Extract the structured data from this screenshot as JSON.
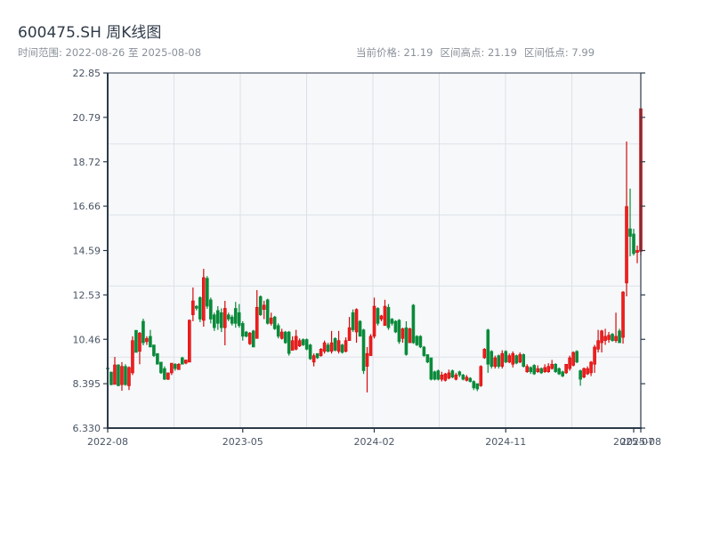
{
  "header": {
    "title": "600475.SH 周K线图",
    "range_label": "时间范围: 2022-08-26 至 2025-08-08",
    "current_price": "当前价格: 21.19",
    "range_high": "区间高点: 21.19",
    "range_low": "区间低点: 7.99"
  },
  "colors": {
    "up": "#d40a0a",
    "up_fill": "#f01e1e",
    "down": "#0a8a3a",
    "plot_bg": "#f6f8fa",
    "grid": "#dde1e8",
    "axis": "#2d3a4a"
  },
  "chart_data": {
    "type": "candlestick",
    "title": "600475.SH 周K线图",
    "ylim": [
      6.33,
      22.85
    ],
    "grid": true,
    "y_ticks": [
      "22.85",
      "20.79",
      "18.72",
      "16.66",
      "14.59",
      "12.53",
      "10.46",
      "8.395",
      "6.330"
    ],
    "x_ticks": [
      {
        "label": "2022-08",
        "index": 0
      },
      {
        "label": "2023-05",
        "index": 38
      },
      {
        "label": "2024-02",
        "index": 75
      },
      {
        "label": "2024-11",
        "index": 112
      },
      {
        "label": "2025-07",
        "index": 148
      },
      {
        "label": "2025-08",
        "index": 150
      }
    ],
    "fields": [
      "open",
      "close",
      "high",
      "low"
    ],
    "candles": [
      [
        9.12,
        9.08,
        9.15,
        9.05
      ],
      [
        8.94,
        8.35,
        8.94,
        8.32
      ],
      [
        8.36,
        9.27,
        9.64,
        8.36
      ],
      [
        9.27,
        8.3,
        9.3,
        8.28
      ],
      [
        8.35,
        9.2,
        9.4,
        8.07
      ],
      [
        9.2,
        8.35,
        9.3,
        8.3
      ],
      [
        8.3,
        9.15,
        9.2,
        8.1
      ],
      [
        8.9,
        10.4,
        10.6,
        8.8
      ],
      [
        10.88,
        9.85,
        10.88,
        9.85
      ],
      [
        9.9,
        10.75,
        10.8,
        9.3
      ],
      [
        11.3,
        10.3,
        11.42,
        10.18
      ],
      [
        10.35,
        10.5,
        10.6,
        10.2
      ],
      [
        10.6,
        10.1,
        10.9,
        10.1
      ],
      [
        10.2,
        9.7,
        10.2,
        9.64
      ],
      [
        9.8,
        9.3,
        9.8,
        9.3
      ],
      [
        9.4,
        8.9,
        9.4,
        8.85
      ],
      [
        9.1,
        8.6,
        9.2,
        8.57
      ],
      [
        8.6,
        8.9,
        8.9,
        8.57
      ],
      [
        8.9,
        9.35,
        9.35,
        8.8
      ],
      [
        9.3,
        9.1,
        9.35,
        9.0
      ],
      [
        9.05,
        9.3,
        9.35,
        9.05
      ],
      [
        9.6,
        9.3,
        9.65,
        9.3
      ],
      [
        9.35,
        9.5,
        9.5,
        9.3
      ],
      [
        9.4,
        11.35,
        11.38,
        9.4
      ],
      [
        11.6,
        12.25,
        12.87,
        11.3
      ],
      [
        12.0,
        11.9,
        12.05,
        11.8
      ],
      [
        12.4,
        11.4,
        12.46,
        11.26
      ],
      [
        11.34,
        13.33,
        13.74,
        11.05
      ],
      [
        13.3,
        12.0,
        13.4,
        11.88
      ],
      [
        12.3,
        11.4,
        12.4,
        11.2
      ],
      [
        11.6,
        11.0,
        11.7,
        10.85
      ],
      [
        11.8,
        11.2,
        12.0,
        10.9
      ],
      [
        11.7,
        11.0,
        11.9,
        10.8
      ],
      [
        11.0,
        11.9,
        12.25,
        10.18
      ],
      [
        11.6,
        11.4,
        11.7,
        11.3
      ],
      [
        11.5,
        11.2,
        11.6,
        11.1
      ],
      [
        11.9,
        11.2,
        12.2,
        11.0
      ],
      [
        11.7,
        11.1,
        12.1,
        11.0
      ],
      [
        11.2,
        10.6,
        11.3,
        10.4
      ],
      [
        10.8,
        10.6,
        10.85,
        10.55
      ],
      [
        10.25,
        10.75,
        10.8,
        10.2
      ],
      [
        10.85,
        10.1,
        10.9,
        10.1
      ],
      [
        10.5,
        11.95,
        12.75,
        10.5
      ],
      [
        12.45,
        11.6,
        12.5,
        11.55
      ],
      [
        11.85,
        12.05,
        12.25,
        11.4
      ],
      [
        12.3,
        11.2,
        12.35,
        11.15
      ],
      [
        11.2,
        11.45,
        11.7,
        11.1
      ],
      [
        11.5,
        10.95,
        11.55,
        10.9
      ],
      [
        11.1,
        10.6,
        11.2,
        10.5
      ],
      [
        10.5,
        10.8,
        10.95,
        10.45
      ],
      [
        10.8,
        10.3,
        10.85,
        10.25
      ],
      [
        10.8,
        9.8,
        10.85,
        9.7
      ],
      [
        9.95,
        10.4,
        10.6,
        9.95
      ],
      [
        10.0,
        10.6,
        10.9,
        9.95
      ],
      [
        10.15,
        10.4,
        10.5,
        10.1
      ],
      [
        10.45,
        10.2,
        10.5,
        10.15
      ],
      [
        10.45,
        10.0,
        10.5,
        9.95
      ],
      [
        10.2,
        9.55,
        10.25,
        9.5
      ],
      [
        9.4,
        9.7,
        9.8,
        9.2
      ],
      [
        9.8,
        9.6,
        9.8,
        9.55
      ],
      [
        9.7,
        10.0,
        10.05,
        9.65
      ],
      [
        9.9,
        10.3,
        10.4,
        9.8
      ],
      [
        10.2,
        9.9,
        10.3,
        9.85
      ],
      [
        9.9,
        10.3,
        10.85,
        9.8
      ],
      [
        10.5,
        9.95,
        10.55,
        9.9
      ],
      [
        9.9,
        10.4,
        10.85,
        9.8
      ],
      [
        10.2,
        9.85,
        10.25,
        9.8
      ],
      [
        9.9,
        10.4,
        10.55,
        9.85
      ],
      [
        10.4,
        11.0,
        11.5,
        10.4
      ],
      [
        11.7,
        10.9,
        11.85,
        10.8
      ],
      [
        10.8,
        11.85,
        11.9,
        10.3
      ],
      [
        11.3,
        10.6,
        11.35,
        10.6
      ],
      [
        10.9,
        9.0,
        10.95,
        8.85
      ],
      [
        9.2,
        9.8,
        10.1,
        7.99
      ],
      [
        9.7,
        10.6,
        10.7,
        9.7
      ],
      [
        10.6,
        12.0,
        12.4,
        10.5
      ],
      [
        11.9,
        11.2,
        11.95,
        11.1
      ],
      [
        11.4,
        11.55,
        11.6,
        11.3
      ],
      [
        11.1,
        12.0,
        12.3,
        11.1
      ],
      [
        11.95,
        11.0,
        12.1,
        10.9
      ],
      [
        11.4,
        11.2,
        11.45,
        11.1
      ],
      [
        11.3,
        10.8,
        11.35,
        10.75
      ],
      [
        11.35,
        10.35,
        11.4,
        10.25
      ],
      [
        10.5,
        10.95,
        11.0,
        10.3
      ],
      [
        11.0,
        9.75,
        11.3,
        9.7
      ],
      [
        10.3,
        10.95,
        11.0,
        10.3
      ],
      [
        12.05,
        10.3,
        12.1,
        10.25
      ],
      [
        10.6,
        10.2,
        10.65,
        10.15
      ],
      [
        10.6,
        10.1,
        10.65,
        10.05
      ],
      [
        10.1,
        9.7,
        10.15,
        9.65
      ],
      [
        9.75,
        9.4,
        9.75,
        9.35
      ],
      [
        9.6,
        8.6,
        9.6,
        8.55
      ],
      [
        8.95,
        8.6,
        9.0,
        8.55
      ],
      [
        9.0,
        8.6,
        9.05,
        8.55
      ],
      [
        8.6,
        8.8,
        8.95,
        8.5
      ],
      [
        8.55,
        8.85,
        8.9,
        8.5
      ],
      [
        8.65,
        8.9,
        9.05,
        8.6
      ],
      [
        9.0,
        8.7,
        9.05,
        8.65
      ],
      [
        8.6,
        8.8,
        8.9,
        8.55
      ],
      [
        8.95,
        8.8,
        9.0,
        8.7
      ],
      [
        8.8,
        8.6,
        8.85,
        8.55
      ],
      [
        8.55,
        8.7,
        8.8,
        8.5
      ],
      [
        8.65,
        8.5,
        8.7,
        8.45
      ],
      [
        8.5,
        8.2,
        8.55,
        8.1
      ],
      [
        8.4,
        8.15,
        8.4,
        8.05
      ],
      [
        8.3,
        9.2,
        9.25,
        8.25
      ],
      [
        9.6,
        10.0,
        10.05,
        9.55
      ],
      [
        10.9,
        9.3,
        10.95,
        8.9
      ],
      [
        9.9,
        9.2,
        9.95,
        9.1
      ],
      [
        9.2,
        9.6,
        9.7,
        9.1
      ],
      [
        9.7,
        9.2,
        9.75,
        9.1
      ],
      [
        9.2,
        9.8,
        9.95,
        9.1
      ],
      [
        9.9,
        9.4,
        9.95,
        9.35
      ],
      [
        9.4,
        9.7,
        9.8,
        9.35
      ],
      [
        9.3,
        9.8,
        9.9,
        9.15
      ],
      [
        9.7,
        9.35,
        9.75,
        9.3
      ],
      [
        9.4,
        9.75,
        9.85,
        9.35
      ],
      [
        9.75,
        9.2,
        9.8,
        9.15
      ],
      [
        8.95,
        9.2,
        9.3,
        8.9
      ],
      [
        9.15,
        8.95,
        9.2,
        8.85
      ],
      [
        9.25,
        8.85,
        9.3,
        8.8
      ],
      [
        8.95,
        9.1,
        9.25,
        8.9
      ],
      [
        9.1,
        8.9,
        9.15,
        8.85
      ],
      [
        8.95,
        9.15,
        9.3,
        8.9
      ],
      [
        8.95,
        9.2,
        9.35,
        8.9
      ],
      [
        9.1,
        9.3,
        9.5,
        9.05
      ],
      [
        9.3,
        8.95,
        9.35,
        8.9
      ],
      [
        9.1,
        8.85,
        9.15,
        8.8
      ],
      [
        8.95,
        8.75,
        9.0,
        8.7
      ],
      [
        8.9,
        9.3,
        9.3,
        8.85
      ],
      [
        9.1,
        9.6,
        9.7,
        9.0
      ],
      [
        9.25,
        9.85,
        9.9,
        9.2
      ],
      [
        9.9,
        9.4,
        9.95,
        9.35
      ],
      [
        9.0,
        8.6,
        9.05,
        8.3
      ],
      [
        8.7,
        9.1,
        9.15,
        8.65
      ],
      [
        8.85,
        9.1,
        9.2,
        8.8
      ],
      [
        8.9,
        9.4,
        9.45,
        8.75
      ],
      [
        9.3,
        10.1,
        10.2,
        8.9
      ],
      [
        10.0,
        10.4,
        10.9,
        9.85
      ],
      [
        10.3,
        10.85,
        10.9,
        9.85
      ],
      [
        10.4,
        10.6,
        10.95,
        10.2
      ],
      [
        10.45,
        10.65,
        10.8,
        10.3
      ],
      [
        10.7,
        10.4,
        10.75,
        10.35
      ],
      [
        10.4,
        10.6,
        11.7,
        10.3
      ],
      [
        10.85,
        10.3,
        10.95,
        10.3
      ],
      [
        10.55,
        12.66,
        12.7,
        10.26
      ],
      [
        13.08,
        16.64,
        19.66,
        12.46
      ],
      [
        15.6,
        15.25,
        17.47,
        14.32
      ],
      [
        15.36,
        14.45,
        15.6,
        14.36
      ],
      [
        14.5,
        14.6,
        14.82,
        14.0
      ],
      [
        14.55,
        21.19,
        21.19,
        14.36
      ]
    ]
  }
}
